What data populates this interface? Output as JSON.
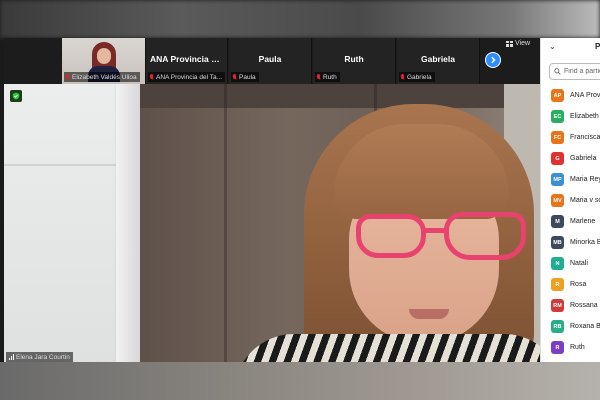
{
  "app": "Zoom Meeting",
  "thumbnails": [
    {
      "display_name": "",
      "label": "Elizabeth Valdés Ulloa",
      "has_video": true,
      "muted": true
    },
    {
      "display_name": "ANA Provincia d...",
      "label": "ANA Provincia del Ta...",
      "has_video": false,
      "muted": true
    },
    {
      "display_name": "Paula",
      "label": "Paula",
      "has_video": false,
      "muted": true
    },
    {
      "display_name": "Ruth",
      "label": "Ruth",
      "has_video": false,
      "muted": true
    },
    {
      "display_name": "Gabriela",
      "label": "Gabriela",
      "has_video": false,
      "muted": true
    }
  ],
  "view_button": "View",
  "speaker": {
    "label": "Elena Jara Courtin"
  },
  "panel": {
    "title": "P",
    "search_placeholder": "Find a partic",
    "participants": [
      {
        "initials": "AP",
        "name": "ANA Provi",
        "color": "#e8751a"
      },
      {
        "initials": "EC",
        "name": "Elizabeth",
        "color": "#27ae60"
      },
      {
        "initials": "FC",
        "name": "Francisca",
        "color": "#e8751a"
      },
      {
        "initials": "G",
        "name": "Gabriela",
        "color": "#e0322e"
      },
      {
        "initials": "MP",
        "name": "Maria Rey",
        "color": "#3a8fd6"
      },
      {
        "initials": "MV",
        "name": "Maria v sc",
        "color": "#e8751a"
      },
      {
        "initials": "M",
        "name": "Marlene",
        "color": "#3d4a5c"
      },
      {
        "initials": "MB",
        "name": "Minorka B",
        "color": "#3d4a5c"
      },
      {
        "initials": "N",
        "name": "Natali",
        "color": "#1fae8f"
      },
      {
        "initials": "R",
        "name": "Rosa",
        "color": "#f0a020"
      },
      {
        "initials": "RM",
        "name": "Rossana n",
        "color": "#d23a3a"
      },
      {
        "initials": "RB",
        "name": "Roxana Be",
        "color": "#27ae88"
      },
      {
        "initials": "R",
        "name": "Ruth",
        "color": "#7b3fc4"
      },
      {
        "initials": "",
        "name": "",
        "color": "#f0a020"
      }
    ]
  }
}
